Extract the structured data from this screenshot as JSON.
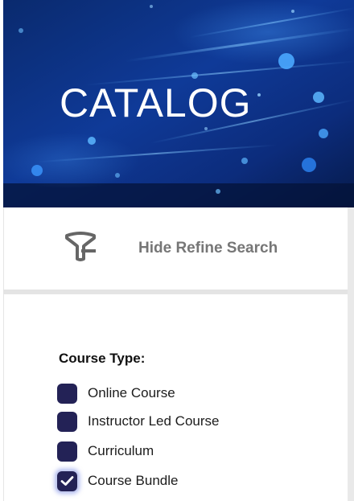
{
  "banner": {
    "title": "CATALOG"
  },
  "refine": {
    "label": "Hide Refine Search",
    "icon": "filter-icon"
  },
  "filters": {
    "heading": "Course Type:",
    "options": [
      {
        "label": "Online Course",
        "checked": false
      },
      {
        "label": "Instructor Led Course",
        "checked": false
      },
      {
        "label": "Curriculum",
        "checked": false
      },
      {
        "label": "Course Bundle",
        "checked": true
      }
    ]
  },
  "colors": {
    "banner_background": "#0d2f7a",
    "checkbox_fill": "#232256",
    "refine_text": "#767676"
  }
}
